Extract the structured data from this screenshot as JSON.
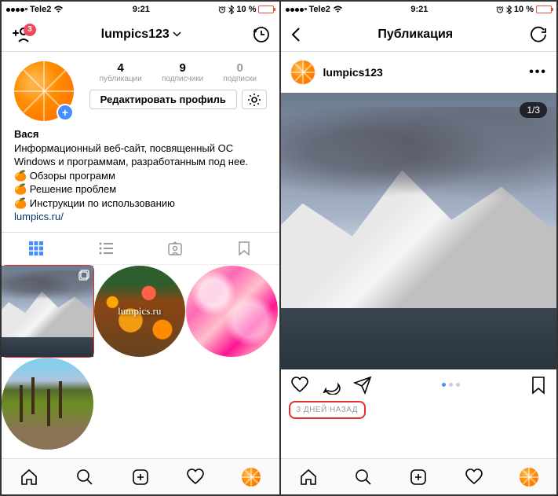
{
  "status": {
    "carrier": "Tele2",
    "time": "9:21",
    "battery_percent": "10 %"
  },
  "left": {
    "header": {
      "notif_count": "3",
      "username": "lumpics123"
    },
    "stats": {
      "posts_count": "4",
      "posts_label": "публикации",
      "followers_count": "9",
      "followers_label": "подписчики",
      "following_count": "0",
      "following_label": "подписки"
    },
    "edit_profile_label": "Редактировать профиль",
    "bio": {
      "display_name": "Вася",
      "line1": "Информационный веб-сайт, посвященный ОС Windows и программам, разработанным под нее.",
      "line2": "🍊 Обзоры программ",
      "line3": "🍊 Решение проблем",
      "line4": "🍊 Инструкции по использованию",
      "link": "lumpics.ru/"
    },
    "grid_logo_text": "lumpics.ru"
  },
  "right": {
    "header_title": "Публикация",
    "post_username": "lumpics123",
    "carousel_badge": "1/3",
    "timestamp": "3 ДНЕЙ НАЗАД"
  }
}
